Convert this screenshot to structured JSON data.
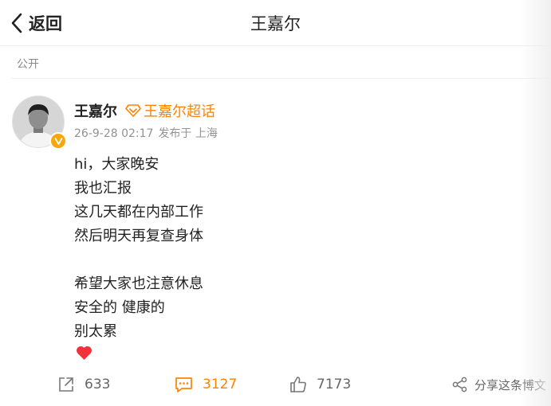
{
  "header": {
    "back_label": "返回",
    "title": "王嘉尔"
  },
  "visibility": "公开",
  "post": {
    "author": "王嘉尔",
    "supertopic": "王嘉尔超话",
    "timestamp": "26-9-28 02:17",
    "source": "发布于 上海",
    "lines": [
      "hi，大家晚安",
      "我也汇报",
      "这几天都在内部工作",
      "然后明天再复查身体",
      "",
      "希望大家也注意休息",
      "安全的 健康的",
      "别太累"
    ],
    "emoji": "heart-icon"
  },
  "actions": {
    "repost_count": "633",
    "comment_count": "3127",
    "like_count": "7173",
    "share_label": "分享这条博文"
  },
  "colors": {
    "accent": "#ff8200",
    "verified": "#f7a60b",
    "heart": "#f0333a",
    "text": "#222222",
    "muted": "#939393"
  }
}
